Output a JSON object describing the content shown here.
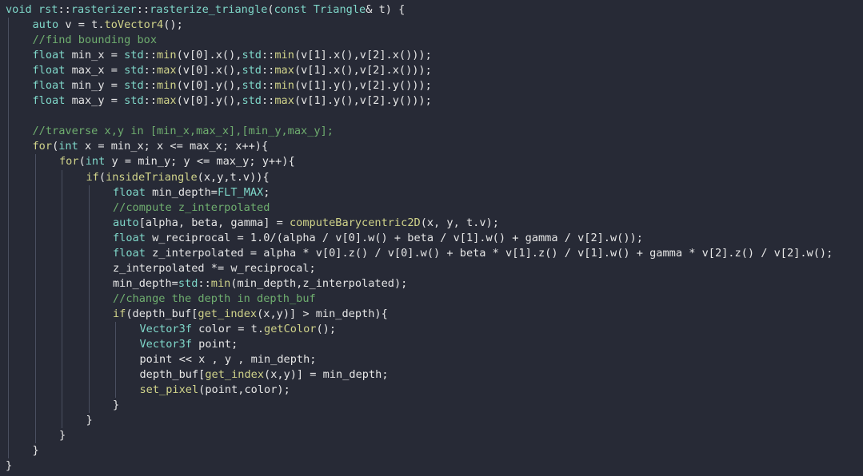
{
  "editor": {
    "language": "cpp",
    "colors": {
      "background": "#272a36",
      "keyword": "#d0d38a",
      "type": "#7fd7c9",
      "comment": "#6fae6f",
      "text": "#e6e6e6",
      "indent_guide": "#4a4f60"
    },
    "lines": [
      {
        "indent": 0,
        "tokens": [
          {
            "t": "void",
            "k": "ty"
          },
          {
            "t": " "
          },
          {
            "t": "rst",
            "k": "ns"
          },
          {
            "t": "::"
          },
          {
            "t": "rasterizer",
            "k": "ns"
          },
          {
            "t": "::"
          },
          {
            "t": "rasterize_triangle",
            "k": "ns"
          },
          {
            "t": "("
          },
          {
            "t": "const",
            "k": "ty"
          },
          {
            "t": " "
          },
          {
            "t": "Triangle",
            "k": "ty"
          },
          {
            "t": "& t) {",
            "k": "op"
          }
        ]
      },
      {
        "indent": 1,
        "tokens": [
          {
            "t": "auto",
            "k": "ty"
          },
          {
            "t": " v = t."
          },
          {
            "t": "toVector4",
            "k": "fn"
          },
          {
            "t": "();"
          }
        ]
      },
      {
        "indent": 1,
        "tokens": [
          {
            "t": "//find bounding box",
            "k": "cm"
          }
        ]
      },
      {
        "indent": 1,
        "tokens": [
          {
            "t": "float",
            "k": "ty"
          },
          {
            "t": " min_x = "
          },
          {
            "t": "std",
            "k": "ns"
          },
          {
            "t": "::"
          },
          {
            "t": "min",
            "k": "fn"
          },
          {
            "t": "(v[0].x(),"
          },
          {
            "t": "std",
            "k": "ns"
          },
          {
            "t": "::"
          },
          {
            "t": "min",
            "k": "fn"
          },
          {
            "t": "(v[1].x(),v[2].x()));"
          }
        ]
      },
      {
        "indent": 1,
        "tokens": [
          {
            "t": "float",
            "k": "ty"
          },
          {
            "t": " max_x = "
          },
          {
            "t": "std",
            "k": "ns"
          },
          {
            "t": "::"
          },
          {
            "t": "max",
            "k": "fn"
          },
          {
            "t": "(v[0].x(),"
          },
          {
            "t": "std",
            "k": "ns"
          },
          {
            "t": "::"
          },
          {
            "t": "max",
            "k": "fn"
          },
          {
            "t": "(v[1].x(),v[2].x()));"
          }
        ]
      },
      {
        "indent": 1,
        "tokens": [
          {
            "t": "float",
            "k": "ty"
          },
          {
            "t": " min_y = "
          },
          {
            "t": "std",
            "k": "ns"
          },
          {
            "t": "::"
          },
          {
            "t": "min",
            "k": "fn"
          },
          {
            "t": "(v[0].y(),"
          },
          {
            "t": "std",
            "k": "ns"
          },
          {
            "t": "::"
          },
          {
            "t": "min",
            "k": "fn"
          },
          {
            "t": "(v[1].y(),v[2].y()));"
          }
        ]
      },
      {
        "indent": 1,
        "tokens": [
          {
            "t": "float",
            "k": "ty"
          },
          {
            "t": " max_y = "
          },
          {
            "t": "std",
            "k": "ns"
          },
          {
            "t": "::"
          },
          {
            "t": "max",
            "k": "fn"
          },
          {
            "t": "(v[0].y(),"
          },
          {
            "t": "std",
            "k": "ns"
          },
          {
            "t": "::"
          },
          {
            "t": "max",
            "k": "fn"
          },
          {
            "t": "(v[1].y(),v[2].y()));"
          }
        ]
      },
      {
        "indent": 1,
        "tokens": []
      },
      {
        "indent": 1,
        "tokens": [
          {
            "t": "//traverse x,y in [min_x,max_x],[min_y,max_y];",
            "k": "cm"
          }
        ]
      },
      {
        "indent": 1,
        "tokens": [
          {
            "t": "for",
            "k": "kw"
          },
          {
            "t": "("
          },
          {
            "t": "int",
            "k": "ty"
          },
          {
            "t": " x = min_x; x <= max_x; x++){"
          }
        ]
      },
      {
        "indent": 2,
        "tokens": [
          {
            "t": "for",
            "k": "kw"
          },
          {
            "t": "("
          },
          {
            "t": "int",
            "k": "ty"
          },
          {
            "t": " y = min_y; y <= max_y; y++){"
          }
        ]
      },
      {
        "indent": 3,
        "tokens": [
          {
            "t": "if",
            "k": "kw"
          },
          {
            "t": "("
          },
          {
            "t": "insideTriangle",
            "k": "fn"
          },
          {
            "t": "(x,y,t.v)){"
          }
        ]
      },
      {
        "indent": 4,
        "tokens": [
          {
            "t": "float",
            "k": "ty"
          },
          {
            "t": " min_depth="
          },
          {
            "t": "FLT_MAX",
            "k": "ty"
          },
          {
            "t": ";"
          }
        ]
      },
      {
        "indent": 4,
        "tokens": [
          {
            "t": "//compute z_interpolated",
            "k": "cm"
          }
        ]
      },
      {
        "indent": 4,
        "tokens": [
          {
            "t": "auto",
            "k": "ty"
          },
          {
            "t": "[alpha, beta, gamma] = "
          },
          {
            "t": "computeBarycentric2D",
            "k": "fn"
          },
          {
            "t": "(x, y, t.v);"
          }
        ]
      },
      {
        "indent": 4,
        "tokens": [
          {
            "t": "float",
            "k": "ty"
          },
          {
            "t": " w_reciprocal = 1.0/(alpha / v[0].w() + beta / v[1].w() + gamma / v[2].w());"
          }
        ]
      },
      {
        "indent": 4,
        "tokens": [
          {
            "t": "float",
            "k": "ty"
          },
          {
            "t": " z_interpolated = alpha * v[0].z() / v[0].w() + beta * v[1].z() / v[1].w() + gamma * v[2].z() / v[2].w();"
          }
        ]
      },
      {
        "indent": 4,
        "tokens": [
          {
            "t": "z_interpolated *= w_reciprocal;"
          }
        ]
      },
      {
        "indent": 4,
        "tokens": [
          {
            "t": "min_depth="
          },
          {
            "t": "std",
            "k": "ns"
          },
          {
            "t": "::"
          },
          {
            "t": "min",
            "k": "fn"
          },
          {
            "t": "(min_depth,z_interpolated);"
          }
        ]
      },
      {
        "indent": 4,
        "tokens": [
          {
            "t": "//change the depth in depth_buf",
            "k": "cm"
          }
        ]
      },
      {
        "indent": 4,
        "tokens": [
          {
            "t": "if",
            "k": "kw"
          },
          {
            "t": "(depth_buf["
          },
          {
            "t": "get_index",
            "k": "fn"
          },
          {
            "t": "(x,y)] > min_depth){"
          }
        ]
      },
      {
        "indent": 5,
        "tokens": [
          {
            "t": "Vector3f",
            "k": "ty"
          },
          {
            "t": " color = t."
          },
          {
            "t": "getColor",
            "k": "fn"
          },
          {
            "t": "();"
          }
        ]
      },
      {
        "indent": 5,
        "tokens": [
          {
            "t": "Vector3f",
            "k": "ty"
          },
          {
            "t": " point;"
          }
        ]
      },
      {
        "indent": 5,
        "tokens": [
          {
            "t": "point << x , y , min_depth;"
          }
        ]
      },
      {
        "indent": 5,
        "tokens": [
          {
            "t": "depth_buf["
          },
          {
            "t": "get_index",
            "k": "fn"
          },
          {
            "t": "(x,y)] = min_depth;"
          }
        ]
      },
      {
        "indent": 5,
        "tokens": [
          {
            "t": "set_pixel",
            "k": "fn"
          },
          {
            "t": "(point,color);"
          }
        ]
      },
      {
        "indent": 4,
        "tokens": [
          {
            "t": "}"
          }
        ]
      },
      {
        "indent": 3,
        "tokens": [
          {
            "t": "}"
          }
        ]
      },
      {
        "indent": 2,
        "tokens": [
          {
            "t": "}"
          }
        ]
      },
      {
        "indent": 1,
        "tokens": [
          {
            "t": "}"
          }
        ]
      },
      {
        "indent": 0,
        "tokens": [
          {
            "t": "}"
          }
        ]
      }
    ]
  }
}
